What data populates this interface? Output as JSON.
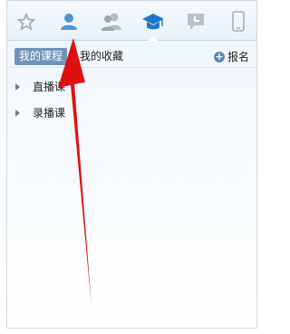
{
  "toolbar": {
    "icons": [
      {
        "name": "star-icon"
      },
      {
        "name": "contact-icon"
      },
      {
        "name": "group-icon"
      },
      {
        "name": "graduation-cap-icon"
      },
      {
        "name": "message-icon"
      },
      {
        "name": "mobile-phone-icon"
      }
    ],
    "active": "graduation-cap-icon"
  },
  "tabs": {
    "my_courses": "我的课程",
    "my_favorites": "我的收藏",
    "signup": "报名"
  },
  "course_list": [
    {
      "label": "直播课"
    },
    {
      "label": "录播课"
    }
  ],
  "colors": {
    "accent": "#3a87c8",
    "tab_active_bg": "#6e95b9",
    "annotation_arrow": "#e01010"
  }
}
